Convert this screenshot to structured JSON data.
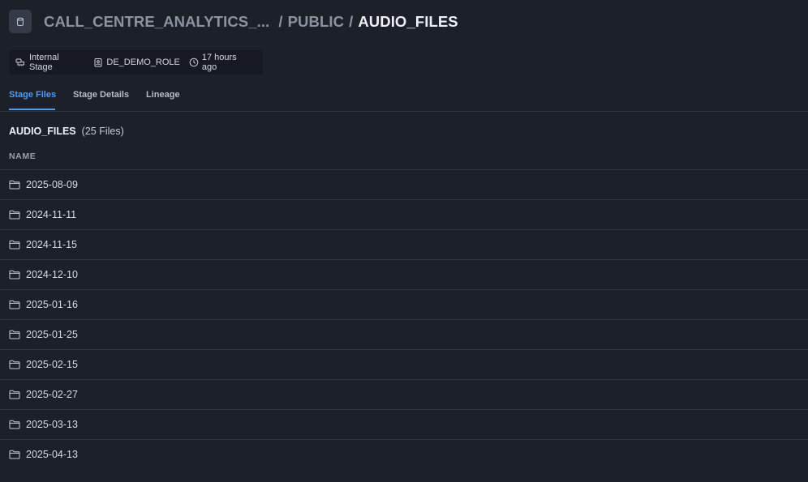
{
  "breadcrumb": {
    "database": "CALL_CENTRE_ANALYTICS_...",
    "separator": "/",
    "schema": "PUBLIC",
    "stage": "AUDIO_FILES"
  },
  "meta": {
    "stage_type": "Internal Stage",
    "role": "DE_DEMO_ROLE",
    "updated": "17 hours ago"
  },
  "tabs": [
    {
      "label": "Stage Files",
      "active": true
    },
    {
      "label": "Stage Details",
      "active": false
    },
    {
      "label": "Lineage",
      "active": false
    }
  ],
  "listing": {
    "title": "AUDIO_FILES",
    "count": "(25 Files)",
    "column_name": "NAME",
    "folders": [
      "2025-08-09",
      "2024-11-11",
      "2024-11-15",
      "2024-12-10",
      "2025-01-16",
      "2025-01-25",
      "2025-02-15",
      "2025-02-27",
      "2025-03-13",
      "2025-04-13"
    ]
  },
  "icons": {
    "stage": "cylinder-icon",
    "stage_type": "cloud-stage-icon",
    "role": "id-badge-icon",
    "updated": "clock-icon",
    "folder": "folder-icon"
  },
  "colors": {
    "background": "#1c2028",
    "accent": "#4d9cf6",
    "divider": "#2f3541"
  }
}
